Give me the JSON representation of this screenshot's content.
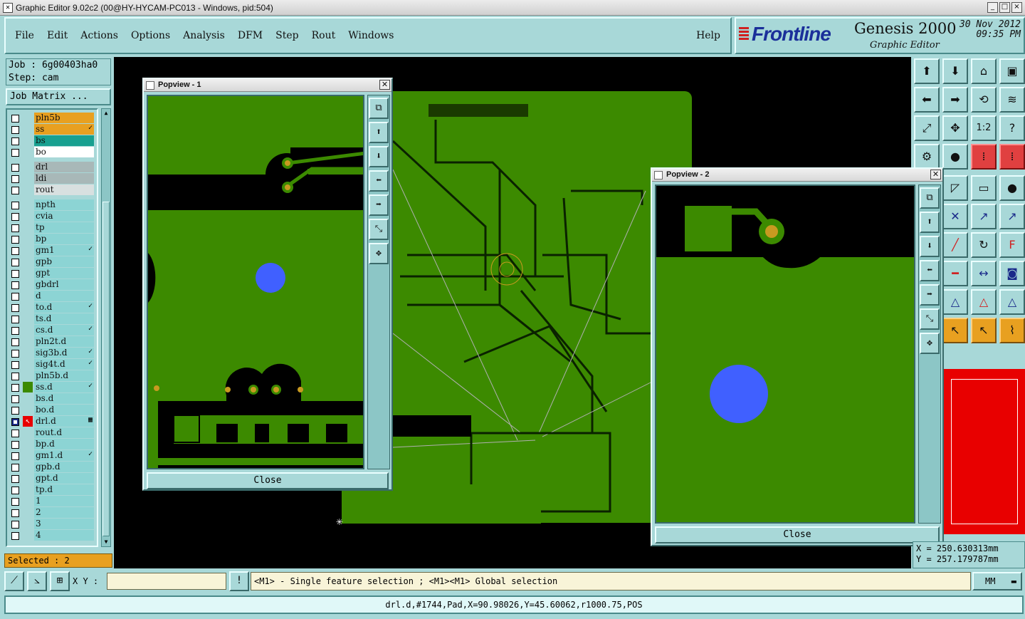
{
  "window": {
    "title": "Graphic Editor 9.02c2 (00@HY-HYCAM-PC013 - Windows, pid:504)",
    "controls": [
      "_",
      "□",
      "×"
    ]
  },
  "menu": [
    "File",
    "Edit",
    "Actions",
    "Options",
    "Analysis",
    "DFM",
    "Step",
    "Rout",
    "Windows"
  ],
  "help": "Help",
  "brand": {
    "logo": "Frontline",
    "product": "Genesis 2000",
    "subtitle": "Graphic Editor",
    "date": "30 Nov 2012",
    "time": "09:35 PM"
  },
  "job": {
    "job_line": "Job : 6g00403ha0",
    "step_line": "Step: cam",
    "matrix_button": "Job Matrix ..."
  },
  "layers": [
    {
      "name": "pln5b",
      "color": "#e8a020",
      "flag": ""
    },
    {
      "name": "ss",
      "color": "#e8a020",
      "flag": "✓"
    },
    {
      "name": "bs",
      "color": "#18a090",
      "flag": ""
    },
    {
      "name": "bo",
      "color": "#ffffff",
      "flag": ""
    },
    {
      "name": "drl",
      "color": "#a8b8b8",
      "flag": ""
    },
    {
      "name": "ldi",
      "color": "#a8b8b8",
      "flag": ""
    },
    {
      "name": "rout",
      "color": "#d8e0e0",
      "flag": ""
    },
    {
      "name": "npth",
      "color": "#8cd4d4",
      "flag": ""
    },
    {
      "name": "cvia",
      "color": "#8cd4d4",
      "flag": ""
    },
    {
      "name": "tp",
      "color": "#8cd4d4",
      "flag": ""
    },
    {
      "name": "bp",
      "color": "#8cd4d4",
      "flag": ""
    },
    {
      "name": "gm1",
      "color": "#8cd4d4",
      "flag": "✓"
    },
    {
      "name": "gpb",
      "color": "#8cd4d4",
      "flag": ""
    },
    {
      "name": "gpt",
      "color": "#8cd4d4",
      "flag": ""
    },
    {
      "name": "gbdrl",
      "color": "#8cd4d4",
      "flag": ""
    },
    {
      "name": "d",
      "color": "#8cd4d4",
      "flag": ""
    },
    {
      "name": "to.d",
      "color": "#8cd4d4",
      "flag": "✓"
    },
    {
      "name": "ts.d",
      "color": "#8cd4d4",
      "flag": ""
    },
    {
      "name": "cs.d",
      "color": "#8cd4d4",
      "flag": "✓"
    },
    {
      "name": "pln2t.d",
      "color": "#8cd4d4",
      "flag": ""
    },
    {
      "name": "sig3b.d",
      "color": "#8cd4d4",
      "flag": "✓"
    },
    {
      "name": "sig4t.d",
      "color": "#8cd4d4",
      "flag": "✓"
    },
    {
      "name": "pln5b.d",
      "color": "#8cd4d4",
      "flag": ""
    },
    {
      "name": "ss.d",
      "color": "#8cd4d4",
      "flag": "✓"
    },
    {
      "name": "bs.d",
      "color": "#8cd4d4",
      "flag": ""
    },
    {
      "name": "bo.d",
      "color": "#8cd4d4",
      "flag": ""
    },
    {
      "name": "drl.d",
      "color": "#8cd4d4",
      "flag": "▦"
    },
    {
      "name": "rout.d",
      "color": "#8cd4d4",
      "flag": ""
    },
    {
      "name": "bp.d",
      "color": "#8cd4d4",
      "flag": ""
    },
    {
      "name": "gm1.d",
      "color": "#8cd4d4",
      "flag": "✓"
    },
    {
      "name": "gpb.d",
      "color": "#8cd4d4",
      "flag": ""
    },
    {
      "name": "gpt.d",
      "color": "#8cd4d4",
      "flag": ""
    },
    {
      "name": "tp.d",
      "color": "#8cd4d4",
      "flag": ""
    },
    {
      "name": "1",
      "color": "#8cd4d4",
      "flag": ""
    },
    {
      "name": "2",
      "color": "#8cd4d4",
      "flag": ""
    },
    {
      "name": "3",
      "color": "#8cd4d4",
      "flag": ""
    },
    {
      "name": "4",
      "color": "#8cd4d4",
      "flag": ""
    }
  ],
  "selected": "Selected : 2",
  "popview1": {
    "title": "Popview - 1",
    "close": "Close"
  },
  "popview2": {
    "title": "Popview - 2",
    "close": "Close"
  },
  "coords": {
    "x": "X = 250.630313mm",
    "y": "Y = 257.179787mm"
  },
  "cmd": {
    "xy_label": "X Y :",
    "xy_value": "",
    "info_icon": "!",
    "message": "<M1> - Single feature selection ; <M1><M1> Global selection",
    "units": "MM"
  },
  "status": "drl.d,#1744,Pad,X=90.98026,Y=45.60062,r1000.75,POS",
  "colors": {
    "panel": "#a8d8d8",
    "board": "#3c8a00",
    "pad": "#c89a20",
    "drill": "#4060ff",
    "highlight": "#e80000"
  }
}
